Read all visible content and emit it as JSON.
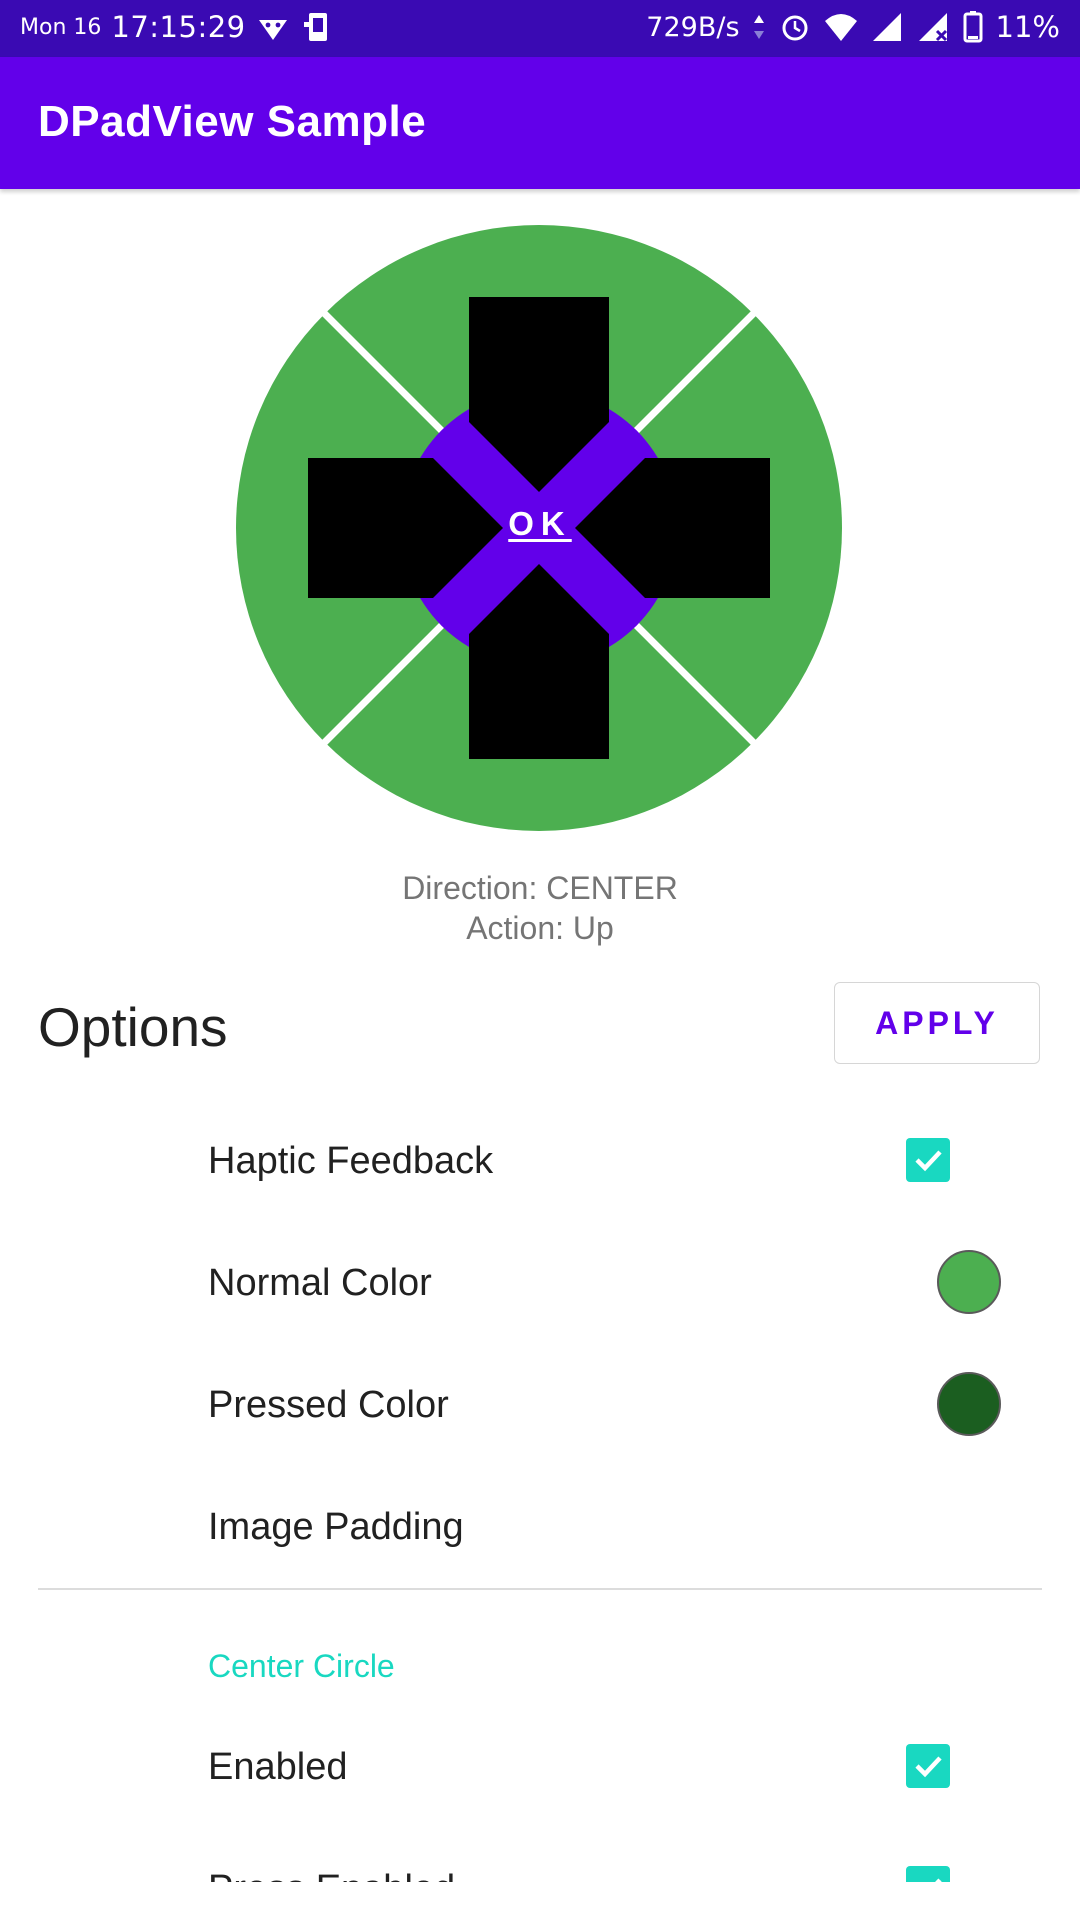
{
  "status_bar": {
    "day": "Mon 16",
    "time": "17:15:29",
    "net_speed": "729B/s",
    "battery": "11%",
    "icons": [
      "bot-icon",
      "phone-icon",
      "data-arrows-icon",
      "alarm-icon",
      "wifi-icon",
      "signal-icon",
      "signal-x-icon",
      "battery-icon"
    ]
  },
  "toolbar": {
    "title": "DPadView Sample"
  },
  "dpad": {
    "center_label": "OK",
    "normal_color": "#4caf50",
    "center_color": "#6200ea",
    "arrow_color": "#000000"
  },
  "status": {
    "direction": "Direction: CENTER",
    "action": "Action: Up"
  },
  "options": {
    "title": "Options",
    "apply_label": "APPLY",
    "haptic_feedback": {
      "label": "Haptic Feedback",
      "checked": true
    },
    "normal_color": {
      "label": "Normal Color",
      "color": "#4caf50"
    },
    "pressed_color": {
      "label": "Pressed Color",
      "color": "#1b5e20"
    },
    "image_padding": {
      "label": "Image Padding"
    },
    "center_circle": {
      "category": "Center Circle",
      "enabled": {
        "label": "Enabled",
        "checked": true
      },
      "press_enabled": {
        "label": "Press Enabled",
        "checked": true
      }
    }
  },
  "accent_color": "#19d8c1"
}
